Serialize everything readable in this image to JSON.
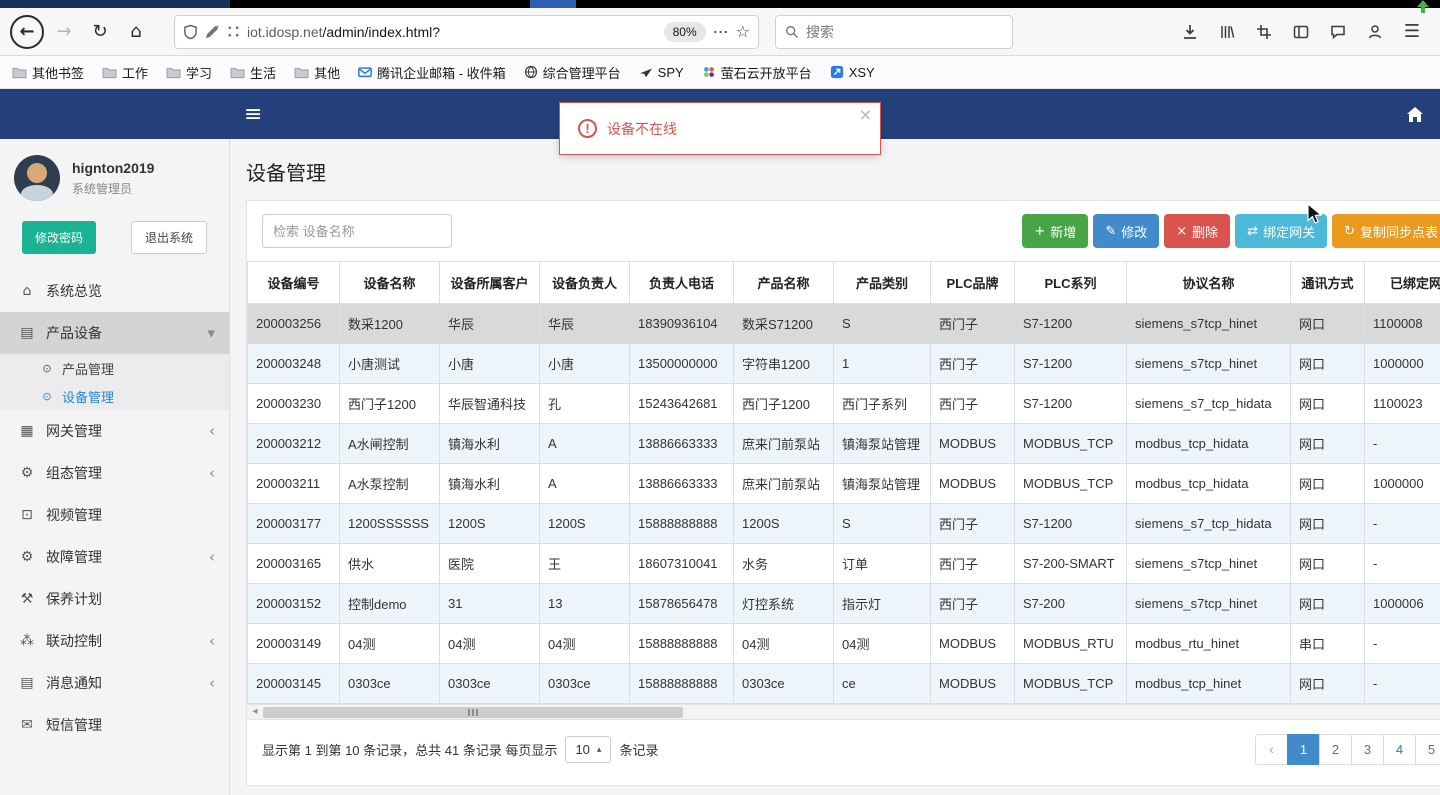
{
  "browser": {
    "url_host": "iot.idosp.net",
    "url_path": "/admin/index.html?",
    "zoom": "80%",
    "search_placeholder": "搜索",
    "bookmarks": [
      {
        "label": "其他书签",
        "type": "folder"
      },
      {
        "label": "工作",
        "type": "folder"
      },
      {
        "label": "学习",
        "type": "folder"
      },
      {
        "label": "生活",
        "type": "folder"
      },
      {
        "label": "其他",
        "type": "folder"
      },
      {
        "label": "腾讯企业邮箱 - 收件箱",
        "type": "site",
        "favicon": "mail"
      },
      {
        "label": "综合管理平台",
        "type": "site",
        "favicon": "platform"
      },
      {
        "label": "SPY",
        "type": "site",
        "favicon": "spy"
      },
      {
        "label": "萤石云开放平台",
        "type": "site",
        "favicon": "ezviz"
      },
      {
        "label": "XSY",
        "type": "site",
        "favicon": "xsy"
      }
    ]
  },
  "app": {
    "toast": {
      "message": "设备不在线"
    },
    "user": {
      "name": "hignton2019",
      "role": "系统管理员",
      "change_pwd": "修改密码",
      "logout": "退出系统"
    },
    "menu": [
      {
        "key": "overview",
        "label": "系统总览",
        "icon": "overview-icon"
      },
      {
        "key": "product-device",
        "label": "产品设备",
        "icon": "product-device-icon",
        "expanded": true,
        "children": [
          {
            "key": "product-manage",
            "label": "产品管理"
          },
          {
            "key": "device-manage",
            "label": "设备管理",
            "active": true
          }
        ]
      },
      {
        "key": "gateway",
        "label": "网关管理",
        "icon": "gateway-icon",
        "collapsible": true
      },
      {
        "key": "scada",
        "label": "组态管理",
        "icon": "scada-icon",
        "collapsible": true
      },
      {
        "key": "video",
        "label": "视频管理",
        "icon": "video-icon"
      },
      {
        "key": "fault",
        "label": "故障管理",
        "icon": "fault-icon",
        "collapsible": true
      },
      {
        "key": "maintenance",
        "label": "保养计划",
        "icon": "maintenance-icon"
      },
      {
        "key": "linkage",
        "label": "联动控制",
        "icon": "linkage-icon",
        "collapsible": true
      },
      {
        "key": "notification",
        "label": "消息通知",
        "icon": "notification-icon",
        "collapsible": true
      },
      {
        "key": "sms",
        "label": "短信管理",
        "icon": "sms-icon"
      }
    ],
    "page": {
      "title": "设备管理",
      "search_placeholder": "检索 设备名称",
      "buttons": [
        {
          "key": "add",
          "label": "新增",
          "icon": "plus-icon",
          "color": "#47a447"
        },
        {
          "key": "edit",
          "label": "修改",
          "icon": "pencil-icon",
          "color": "#428bca"
        },
        {
          "key": "delete",
          "label": "删除",
          "icon": "cross-icon",
          "color": "#d9534f"
        },
        {
          "key": "bind-gateway",
          "label": "绑定网关",
          "icon": "link-icon",
          "color": "#4cb9d8"
        },
        {
          "key": "copy-sync-table",
          "label": "复制同步点表",
          "icon": "sync-icon",
          "color": "#ec9a1e"
        }
      ],
      "table": {
        "columns": [
          "设备编号",
          "设备名称",
          "设备所属客户",
          "设备负责人",
          "负责人电话",
          "产品名称",
          "产品类别",
          "PLC品牌",
          "PLC系列",
          "协议名称",
          "通讯方式",
          "已绑定网关"
        ],
        "rows": [
          [
            "200003256",
            "数采1200",
            "华辰",
            "华辰",
            "18390936104",
            "数采S71200",
            "S",
            "西门子",
            "S7-1200",
            "siemens_s7tcp_hinet",
            "网口",
            "1100008"
          ],
          [
            "200003248",
            "小唐测试",
            "小唐",
            "小唐",
            "13500000000",
            "字符串1200",
            "1",
            "西门子",
            "S7-1200",
            "siemens_s7tcp_hinet",
            "网口",
            "1000000"
          ],
          [
            "200003230",
            "西门子1200",
            "华辰智通科技",
            "孔",
            "15243642681",
            "西门子1200",
            "西门子系列",
            "西门子",
            "S7-1200",
            "siemens_s7_tcp_hidata",
            "网口",
            "1100023"
          ],
          [
            "200003212",
            "A水闸控制",
            "镇海水利",
            "A",
            "13886663333",
            "庶来门前泵站",
            "镇海泵站管理",
            "MODBUS",
            "MODBUS_TCP",
            "modbus_tcp_hidata",
            "网口",
            "-"
          ],
          [
            "200003211",
            "A水泵控制",
            "镇海水利",
            "A",
            "13886663333",
            "庶来门前泵站",
            "镇海泵站管理",
            "MODBUS",
            "MODBUS_TCP",
            "modbus_tcp_hidata",
            "网口",
            "1000000"
          ],
          [
            "200003177",
            "1200SSSSSS",
            "1200S",
            "1200S",
            "15888888888",
            "1200S",
            "S",
            "西门子",
            "S7-1200",
            "siemens_s7_tcp_hidata",
            "网口",
            "-"
          ],
          [
            "200003165",
            "供水",
            "医院",
            "王",
            "18607310041",
            "水务",
            "订单",
            "西门子",
            "S7-200-SMART",
            "siemens_s7tcp_hinet",
            "网口",
            "-"
          ],
          [
            "200003152",
            "控制demo",
            "31",
            "13",
            "15878656478",
            "灯控系统",
            "指示灯",
            "西门子",
            "S7-200",
            "siemens_s7tcp_hinet",
            "网口",
            "1000006"
          ],
          [
            "200003149",
            "04测",
            "04测",
            "04测",
            "15888888888",
            "04测",
            "04测",
            "MODBUS",
            "MODBUS_RTU",
            "modbus_rtu_hinet",
            "串口",
            "-"
          ],
          [
            "200003145",
            "0303ce",
            "0303ce",
            "0303ce",
            "15888888888",
            "0303ce",
            "ce",
            "MODBUS",
            "MODBUS_TCP",
            "modbus_tcp_hinet",
            "网口",
            "-"
          ]
        ],
        "selected_row": 0
      },
      "pagination": {
        "summary_prefix": "显示第 1 到第 10 条记录，总共 41 条记录 每页显示",
        "page_size": "10",
        "summary_suffix": "条记录",
        "prev_label": "‹",
        "next_label": "›",
        "pages": [
          "1",
          "2",
          "3",
          "4",
          "5"
        ],
        "active_page": "1"
      }
    }
  }
}
